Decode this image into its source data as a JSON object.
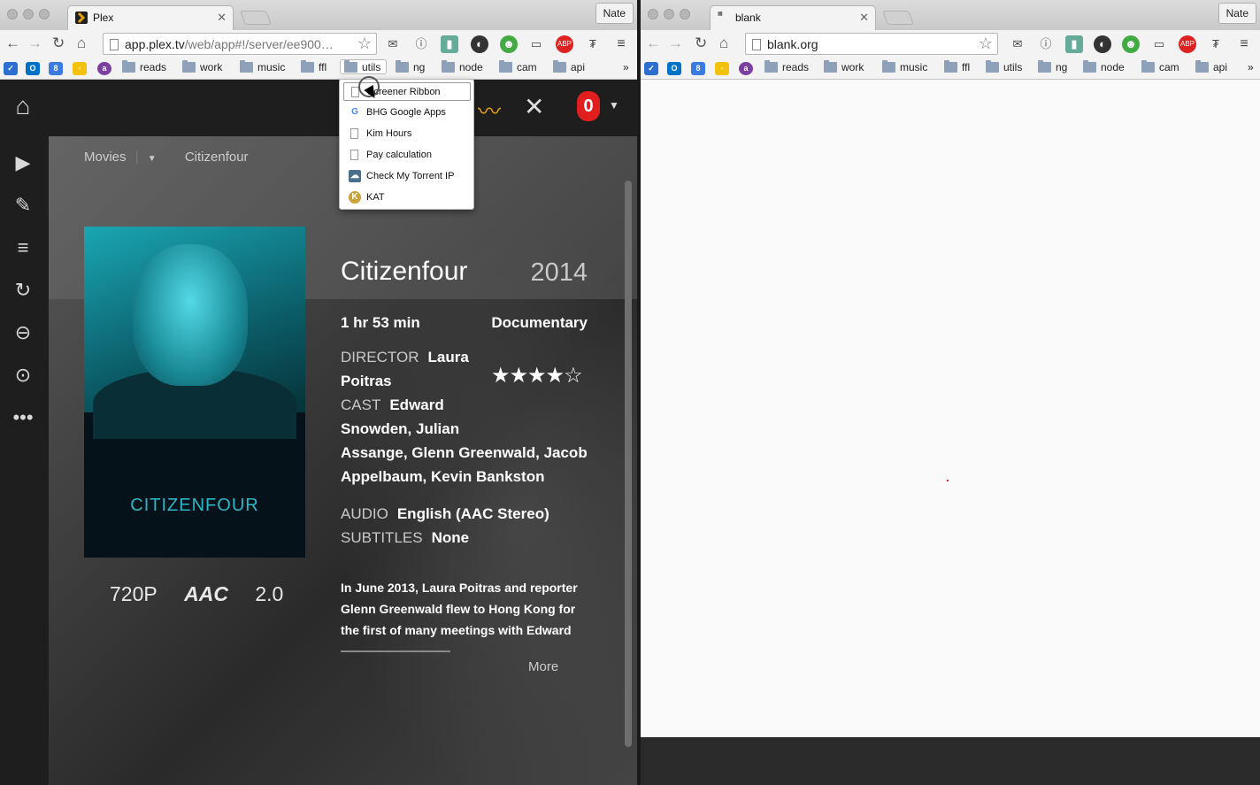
{
  "left_window": {
    "tab_title": "Plex",
    "profile": "Nate",
    "url_main": "app.plex.tv",
    "url_rest": "/web/app#!/server/ee900…",
    "bookmarks": [
      "reads",
      "work",
      "music",
      "ffl",
      "utils",
      "ng",
      "node",
      "cam",
      "api"
    ],
    "bookmarks_overflow": "»",
    "utils_menu": [
      {
        "label": "Screener Ribbon",
        "icon": "page-icon"
      },
      {
        "label": "BHG Google Apps",
        "icon": "google-icon"
      },
      {
        "label": "Kim Hours",
        "icon": "page-icon"
      },
      {
        "label": "Pay calculation",
        "icon": "page-icon"
      },
      {
        "label": "Check My Torrent IP",
        "icon": "cloud-icon"
      },
      {
        "label": "KAT",
        "icon": "kat-icon"
      }
    ]
  },
  "plex": {
    "breadcrumb_section": "Movies",
    "breadcrumb_item": "Citizenfour",
    "poster_title": "CITIZENFOUR",
    "title": "Citizenfour",
    "year": "2014",
    "duration": "1 hr 53 min",
    "genre": "Documentary",
    "director_label": "DIRECTOR",
    "director_line1": "Laura",
    "director_line2": "Poitras",
    "rating_stars": "★★★★☆",
    "rating_value": 4,
    "cast_label": "CAST",
    "cast_line1": "Edward",
    "cast_line2": "Snowden, Julian",
    "cast_line3": "Assange, Glenn Greenwald, Jacob",
    "cast_line4": "Appelbaum, Kevin Bankston",
    "audio_label": "AUDIO",
    "audio_value": "English (AAC Stereo)",
    "subtitles_label": "SUBTITLES",
    "subtitles_value": "None",
    "badge_resolution": "720P",
    "badge_codec": "AAC",
    "badge_channels": "2.0",
    "summary": "In June 2013, Laura Poitras and reporter Glenn Greenwald flew to Hong Kong for the first of many meetings with Edward",
    "more_label": "More"
  },
  "right_window": {
    "tab_title": "blank",
    "profile": "Nate",
    "url": "blank.org",
    "bookmarks": [
      "reads",
      "work",
      "music",
      "ffl",
      "utils",
      "ng",
      "node",
      "cam",
      "api"
    ],
    "bookmarks_overflow": "»"
  }
}
